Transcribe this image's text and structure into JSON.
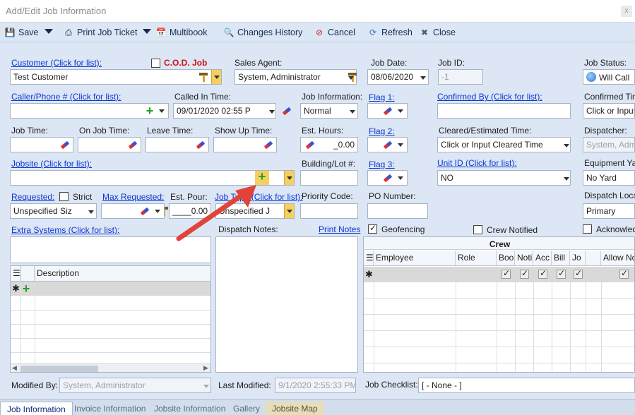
{
  "window": {
    "title": "Add/Edit Job Information",
    "close": "x"
  },
  "toolbar": {
    "save": "Save",
    "print_ticket": "Print Job Ticket",
    "multibook": "Multibook",
    "changes_history": "Changes History",
    "cancel": "Cancel",
    "refresh": "Refresh",
    "close": "Close"
  },
  "form": {
    "customer_link": "Customer (Click for list):",
    "customer_value": "Test Customer",
    "cod_label": "C.O.D. Job",
    "sales_agent_label": "Sales Agent:",
    "sales_agent_value": "System, Administrator",
    "job_date_label": "Job Date:",
    "job_date_value": "08/06/2020",
    "job_id_label": "Job ID:",
    "job_id_value": "-1",
    "job_status_label": "Job Status:",
    "job_status_value": "Will Call",
    "caller_link": "Caller/Phone # (Click for list):",
    "called_in_label": "Called In Time:",
    "called_in_value": "09/01/2020 02:55 P",
    "job_info_label": "Job Information:",
    "job_info_value": "Normal",
    "flag1": "Flag 1:",
    "confirmed_by_link": "Confirmed By (Click for list):",
    "confirmed_time_label": "Confirmed Tim",
    "confirmed_time_value": "Click or Input",
    "job_time_label": "Job Time:",
    "on_job_time_label": "On Job Time:",
    "leave_time_label": "Leave Time:",
    "show_up_label": "Show Up Time:",
    "est_hours_label": "Est. Hours:",
    "est_hours_value": "_0.00",
    "flag2": "Flag 2:",
    "cleared_label": "Cleared/Estimated Time:",
    "cleared_value": "Click or Input Cleared Time",
    "dispatcher_label": "Dispatcher:",
    "dispatcher_value": "System, Admi",
    "jobsite_link": "Jobsite (Click for list):",
    "building_label": "Building/Lot #:",
    "flag3": "Flag 3:",
    "unit_id_link": "Unit ID (Click for list):",
    "unit_id_value": "NO",
    "equipment_label": "Equipment Yar",
    "equipment_value": "No Yard",
    "requested_link": "Requested:",
    "strict_label": "Strict",
    "max_requested_link": "Max Requested:",
    "est_pour_label": "Est. Pour:",
    "est_pour_value": "____0.00",
    "job_type_link": "Job Type (Click for list):",
    "job_type_value": "Unspecified J",
    "priority_label": "Priority Code:",
    "po_label": "PO Number:",
    "dispatch_loc_label": "Dispatch Loca",
    "dispatch_loc_value": "Primary",
    "requested_value": "Unspecified Siz",
    "extra_systems_link": "Extra Systems (Click for list):",
    "dispatch_notes_label": "Dispatch Notes:",
    "print_notes_link": "Print Notes",
    "geofencing_label": "Geofencing",
    "crew_notified_label": "Crew Notified",
    "acknowledged_label": "Acknowled",
    "description_header": "Description",
    "crew_title": "Crew",
    "crew_headers": [
      "Employee",
      "Role",
      "Boo",
      "Noti",
      "Acc",
      "Bill",
      "Jo",
      "",
      "Allow No"
    ],
    "modified_by_label": "Modified By:",
    "modified_by_value": "System, Administrator",
    "last_modified_label": "Last Modified:",
    "last_modified_value": "9/1/2020 2:55:33 PM",
    "checklist_label": "Job Checklist:",
    "checklist_value": "[ - None - ]"
  },
  "tabs": [
    "Job Information",
    "Invoice Information",
    "Jobsite Information",
    "Gallery",
    "Jobsite Map"
  ],
  "colors": {
    "accent_arrow": "#e0433a",
    "link": "#0b36d6",
    "cod_red": "#d01010"
  }
}
